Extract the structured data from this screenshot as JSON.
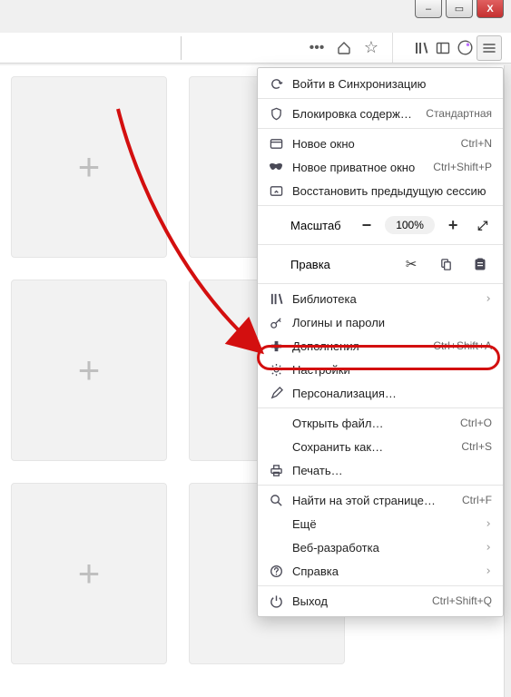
{
  "window": {
    "minimize": "–",
    "maximize": "▭",
    "close": "X"
  },
  "toolbar": {
    "more": "•••",
    "pocket": "⌄",
    "star": "☆",
    "library": "|||\\",
    "sidebar": "▥",
    "firefox_account": "◉",
    "menu": "≡"
  },
  "tile": {
    "plus": "+"
  },
  "menu": {
    "sync": "Войти в Синхронизацию",
    "content_blocking": "Блокировка содержимого",
    "content_blocking_state": "Стандартная",
    "new_window": {
      "label": "Новое окно",
      "shortcut": "Ctrl+N"
    },
    "private_window": {
      "label": "Новое приватное окно",
      "shortcut": "Ctrl+Shift+P"
    },
    "restore_session": "Восстановить предыдущую сессию",
    "zoom": {
      "label": "Масштаб",
      "minus": "−",
      "pct": "100%",
      "plus": "+",
      "fullscreen": "⤢"
    },
    "edit": {
      "label": "Правка",
      "cut": "✂",
      "copy": "⎘",
      "paste": "📋"
    },
    "library": "Библиотека",
    "logins": "Логины и пароли",
    "addons": {
      "label": "Дополнения",
      "shortcut": "Ctrl+Shift+A"
    },
    "settings": "Настройки",
    "customize": "Персонализация…",
    "open_file": {
      "label": "Открыть файл…",
      "shortcut": "Ctrl+O"
    },
    "save_as": {
      "label": "Сохранить как…",
      "shortcut": "Ctrl+S"
    },
    "print": "Печать…",
    "find": {
      "label": "Найти на этой странице…",
      "shortcut": "Ctrl+F"
    },
    "more": "Ещё",
    "webdev": "Веб-разработка",
    "help": "Справка",
    "exit": {
      "label": "Выход",
      "shortcut": "Ctrl+Shift+Q"
    }
  },
  "chev": "›"
}
